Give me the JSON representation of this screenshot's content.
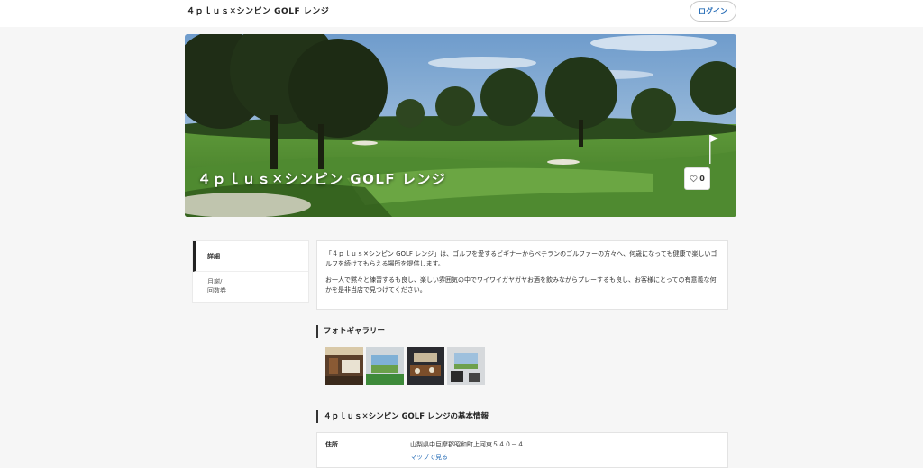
{
  "header": {
    "brand": "４ｐｌｕｓ✕シンピン GOLF レンジ",
    "login_label": "ログイン"
  },
  "hero": {
    "title": "４ｐｌｕｓ✕シンピン GOLF レンジ",
    "favorite_count": "0"
  },
  "nav": {
    "items": [
      {
        "label": "詳細"
      },
      {
        "label_line1": "月謝/",
        "label_line2": "回数券"
      }
    ]
  },
  "description": {
    "paragraph1": "「４ｐｌｕｓ✕シンピン GOLF レンジ」は、ゴルフを愛するビギナーからベテランのゴルファーの方々へ、何歳になっても健康で楽しいゴルフを続けてもらえる場所を提供します。",
    "paragraph2": "お一人で黙々と練習するも良し、楽しい雰囲気の中でワイワイガヤガヤお酒を飲みながらプレーするも良し、お客様にとっての有意義な何かを是非当店で見つけてください。"
  },
  "gallery": {
    "title": "フォトギャラリー"
  },
  "basic_info": {
    "title": "４ｐｌｕｓ✕シンピン GOLF レンジの基本情報",
    "address_label": "住所",
    "address_value": "山梨県中巨摩郡昭和町上河東５４０－４",
    "map_link": "マップで見る"
  }
}
